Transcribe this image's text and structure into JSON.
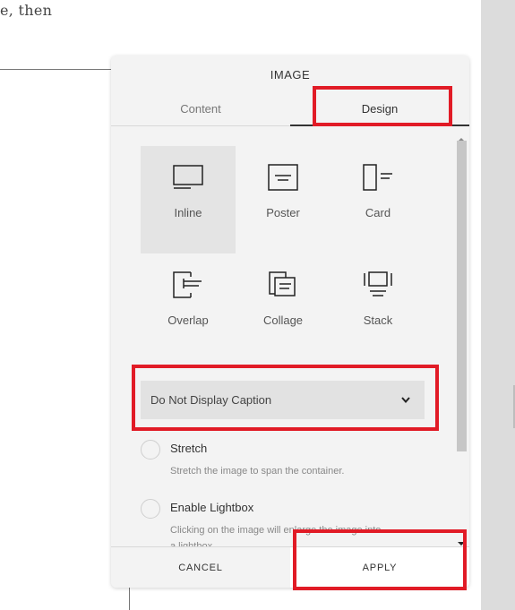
{
  "background": {
    "snippet_text": "e, then"
  },
  "panel": {
    "title": "IMAGE",
    "tabs": [
      {
        "label": "Content",
        "active": false
      },
      {
        "label": "Design",
        "active": true
      }
    ],
    "layouts": [
      {
        "label": "Inline",
        "icon": "inline-layout-icon",
        "selected": true
      },
      {
        "label": "Poster",
        "icon": "poster-layout-icon",
        "selected": false
      },
      {
        "label": "Card",
        "icon": "card-layout-icon",
        "selected": false
      },
      {
        "label": "Overlap",
        "icon": "overlap-layout-icon",
        "selected": false
      },
      {
        "label": "Collage",
        "icon": "collage-layout-icon",
        "selected": false
      },
      {
        "label": "Stack",
        "icon": "stack-layout-icon",
        "selected": false
      }
    ],
    "caption_select": {
      "value": "Do Not Display Caption",
      "icon": "chevron-down-icon"
    },
    "toggles": [
      {
        "label": "Stretch",
        "description": "Stretch the image to span the container.",
        "checked": false
      },
      {
        "label": "Enable Lightbox",
        "description": "Clicking on the image will enlarge the image into",
        "description_cont": "a lightbox.",
        "checked": false
      }
    ],
    "footer": {
      "cancel_label": "CANCEL",
      "apply_label": "APPLY"
    }
  },
  "colors": {
    "highlight": "#e11b26",
    "panel_bg": "#f3f3f3",
    "selected_bg": "#e4e4e4"
  }
}
